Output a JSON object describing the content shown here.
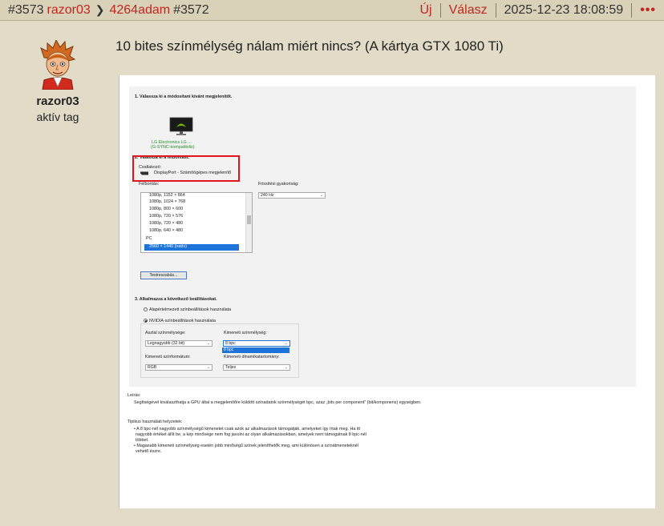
{
  "header": {
    "post_number": "#3573",
    "author": "razor03",
    "reply_to_user": "4264adam",
    "reply_to_number": "#3572",
    "new_label": "Új",
    "reply_label": "Válasz",
    "datetime": "2025-12-23 18:08:59",
    "more_label": "•••"
  },
  "author": {
    "name": "razor03",
    "rank": "aktív tag"
  },
  "post": {
    "title": "10 bites színmélység nálam miért nincs? (A kártya GTX 1080 Ti)"
  },
  "screenshot": {
    "step1": "1. Válassza ki a módosítani kívánt megjelenítőt.",
    "monitor_name": "LG Electronics LG ...",
    "monitor_sub": "(G-SYNC-kompatibilis)",
    "step2": "2. Válassza ki a felbontást.",
    "connector_label": "Csatlakozó:",
    "connector_value": "DisplayPort - Számítógépes megjelenítő",
    "resolution_label": "Felbontás:",
    "resolutions": [
      "1080p, 1152 × 864",
      "1080p, 1024 × 768",
      "1080p, 800 × 600",
      "1080p, 720 × 576",
      "1080p, 720 × 480",
      "1080p, 640 × 480",
      "PC",
      "2560 × 1440 (natív)"
    ],
    "refresh_label": "Frissítési gyakoriság:",
    "refresh_value": "240 Hz",
    "customize_button": "Testreszabás...",
    "step3": "3. Alkalmazza a következő beállításokat.",
    "radio_default": "Alapértelmezett színbeállítások használata",
    "radio_nvidia": "NVIDIA-színbeállítások használata",
    "desktop_depth_label": "Asztal színmélysége:",
    "desktop_depth_value": "Legnagyobb (32 bit)",
    "output_depth_label": "Kimeneti színmélység:",
    "output_depth_value": "8 bpc",
    "output_depth_option": "8 bpc",
    "color_format_label": "Kimeneti színformátum:",
    "color_format_value": "RGB",
    "dynamic_range_label": "Kimeneti dinamikatartomány:",
    "dynamic_range_value": "Teljes",
    "desc_title": "Leírás:",
    "desc_text": "Segítségével kiválaszthatja a GPU által a megjelenítőre küldött színadatok színmélységét bpc, azaz „bits per component” (bit/komponens) egységben.",
    "usage_title": "Tipikus használati helyzetek:",
    "usage_1a": "• A 8 bpc-nél nagyobb színmélységű kimenetet csak azok az alkalmazások támogatják, amelyeket így írtak meg. Ha itt",
    "usage_1b": "nagyobb értéket állít be, a kép minősége nem fog javulni az olyan alkalmazásokban, amelyek nem támogatnak 8 bpc-nél",
    "usage_1c": "többet.",
    "usage_2a": "• Magasabb kimeneti színmélység esetén jobb minőségű színek jeleníthetők meg, ami különösen a színátmeneteknél",
    "usage_2b": "vehető észre."
  }
}
